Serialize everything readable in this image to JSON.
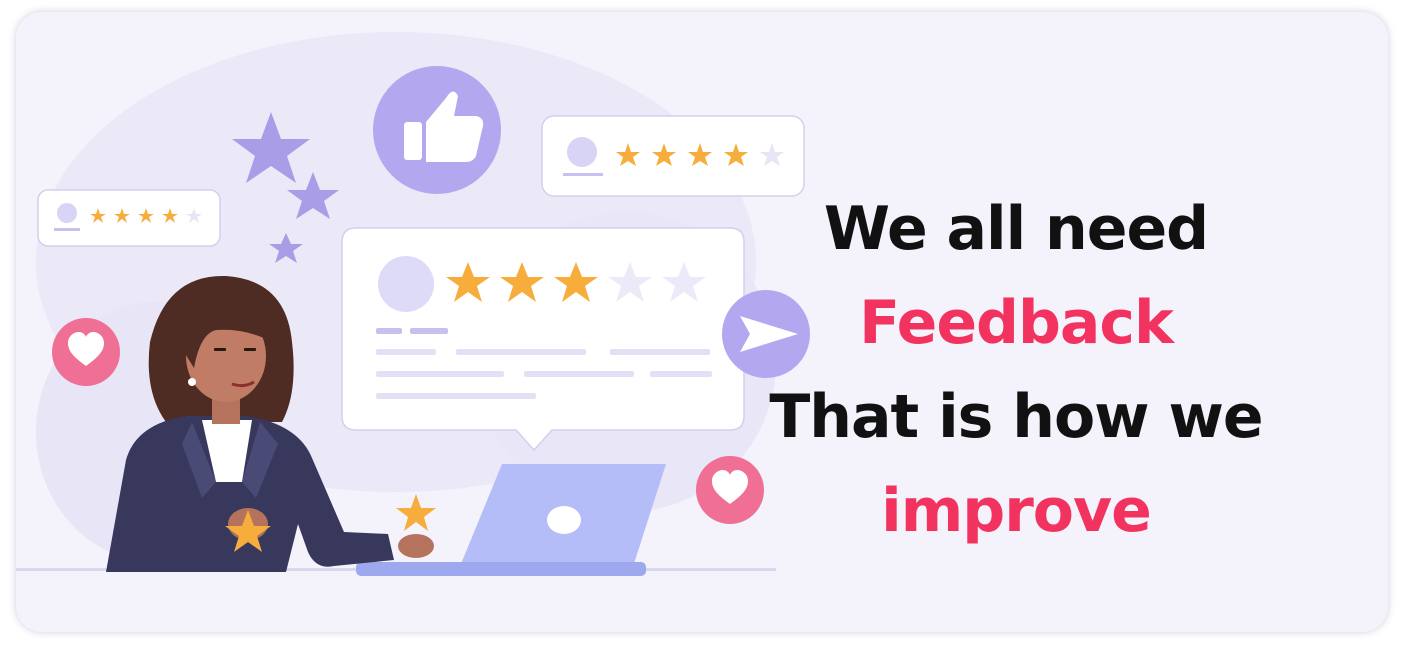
{
  "headline": {
    "line1": "We all need",
    "line2": "Feedback",
    "line3": "That is how we",
    "line4": "improve"
  },
  "colors": {
    "card_background": "#f4f2fb",
    "text_dark": "#111111",
    "text_accent": "#f2335f",
    "illustration_purple": "#b9b0ee",
    "star_gold": "#f6ad3c",
    "heart_pink": "#ef6f95"
  },
  "reviews": {
    "main_review_rating": 3,
    "small_review_left_rating": 4,
    "small_review_right_rating": 4,
    "max_rating": 5
  },
  "icons": [
    "thumbs-up-icon",
    "heart-icon",
    "send-icon",
    "star-icon",
    "avatar-icon"
  ]
}
